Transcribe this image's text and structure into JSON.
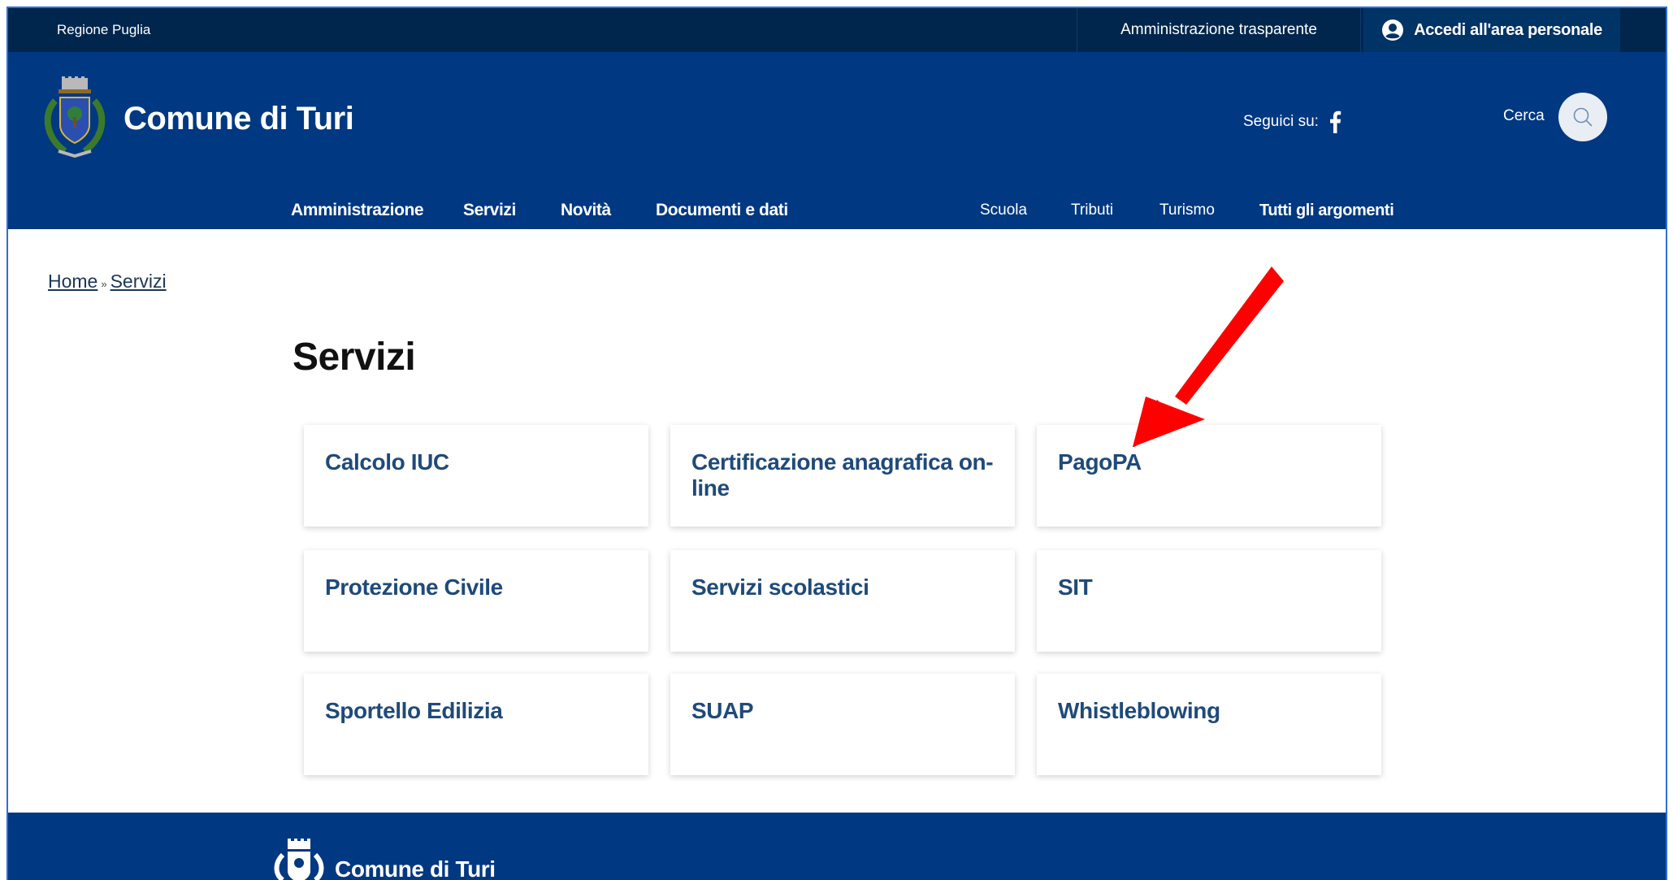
{
  "topbar": {
    "region": "Regione Puglia",
    "transparency_link": "Amministrazione trasparente",
    "login_label": "Accedi all'area personale"
  },
  "header": {
    "site_title": "Comune di Turi",
    "follow_label": "Seguici su:",
    "search_label": "Cerca",
    "logo_icon": "municipal-crest-icon",
    "social_icon": "facebook-icon"
  },
  "nav": {
    "main": [
      "Amministrazione",
      "Servizi",
      "Novità",
      "Documenti e dati"
    ],
    "topics": [
      "Scuola",
      "Tributi",
      "Turismo"
    ],
    "all_topics": "Tutti gli argomenti"
  },
  "breadcrumb": {
    "home": "Home",
    "separator": "»",
    "current": "Servizi"
  },
  "page": {
    "title": "Servizi"
  },
  "services": [
    "Calcolo IUC",
    "Certificazione anagrafica on-line",
    "PagoPA",
    "Protezione Civile",
    "Servizi scolastici",
    "SIT",
    "Sportello Edilizia",
    "SUAP",
    "Whistleblowing"
  ],
  "annotation": {
    "icon": "red-arrow-icon",
    "target": "PagoPA",
    "color": "#ff0000"
  },
  "footer": {
    "site_title": "Comune di Turi"
  },
  "colors": {
    "topbar_bg": "#00264d",
    "header_bg": "#003882",
    "card_text": "#1f4a7a",
    "arrow": "#ff0000"
  }
}
